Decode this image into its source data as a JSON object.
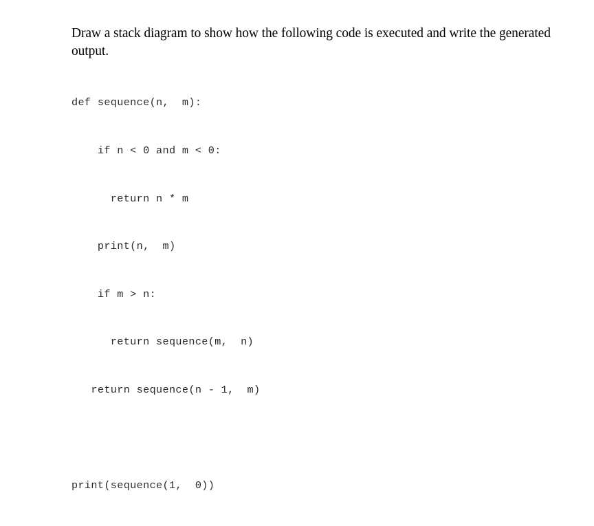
{
  "document": {
    "prompt": "Draw a stack diagram to show how the following code is executed and write the generated output.",
    "code_lines": [
      "def sequence(n,  m):",
      "    if n < 0 and m < 0:",
      "      return n * m",
      "    print(n,  m)",
      "    if m > n:",
      "      return sequence(m,  n)",
      "   return sequence(n - 1,  m)",
      "",
      "print(sequence(1,  0))"
    ],
    "colors": {
      "background": "#ffffff",
      "prompt_text": "#010101",
      "code_text": "#2a2a2a"
    }
  }
}
